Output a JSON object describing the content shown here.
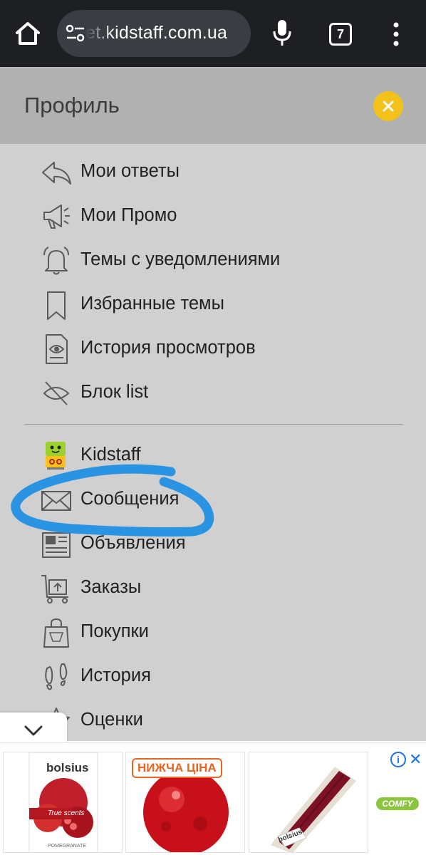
{
  "browser": {
    "url": "et.kidstaff.com.ua",
    "tab_count": "7"
  },
  "panel": {
    "title": "Профиль",
    "items": [
      {
        "label": "Мои ответы",
        "icon": "reply-icon"
      },
      {
        "label": "Мои Промо",
        "icon": "megaphone-icon"
      },
      {
        "label": "Темы с уведомлениями",
        "icon": "bell-icon"
      },
      {
        "label": "Избранные темы",
        "icon": "bookmark-icon"
      },
      {
        "label": "История просмотров",
        "icon": "eye-document-icon"
      },
      {
        "label": "Блок list",
        "icon": "hidden-eye-icon"
      },
      {
        "label": "Kidstaff",
        "icon": "kidstaff-logo-icon"
      },
      {
        "label": "Сообщения",
        "icon": "envelope-icon"
      },
      {
        "label": "Объявления",
        "icon": "newspaper-icon"
      },
      {
        "label": "Заказы",
        "icon": "cart-icon"
      },
      {
        "label": "Покупки",
        "icon": "shopping-bag-icon"
      },
      {
        "label": "История",
        "icon": "footprints-icon"
      },
      {
        "label": "Оценки",
        "icon": "star-icon"
      }
    ]
  },
  "ads": {
    "ad1_brand": "bolsius",
    "ad1_tagline": "True scents",
    "ad1_caption": "POMEGRANATE",
    "ad2_badge": "НИЖЧА ЦІНА",
    "ad3_brand": "bolsius",
    "advertiser": "COMFY"
  },
  "colors": {
    "accent_yellow": "#f3c21a",
    "panel_bg": "#d0d0d0",
    "header_bg": "#b1b1b1",
    "highlight": "#2b94e2"
  }
}
